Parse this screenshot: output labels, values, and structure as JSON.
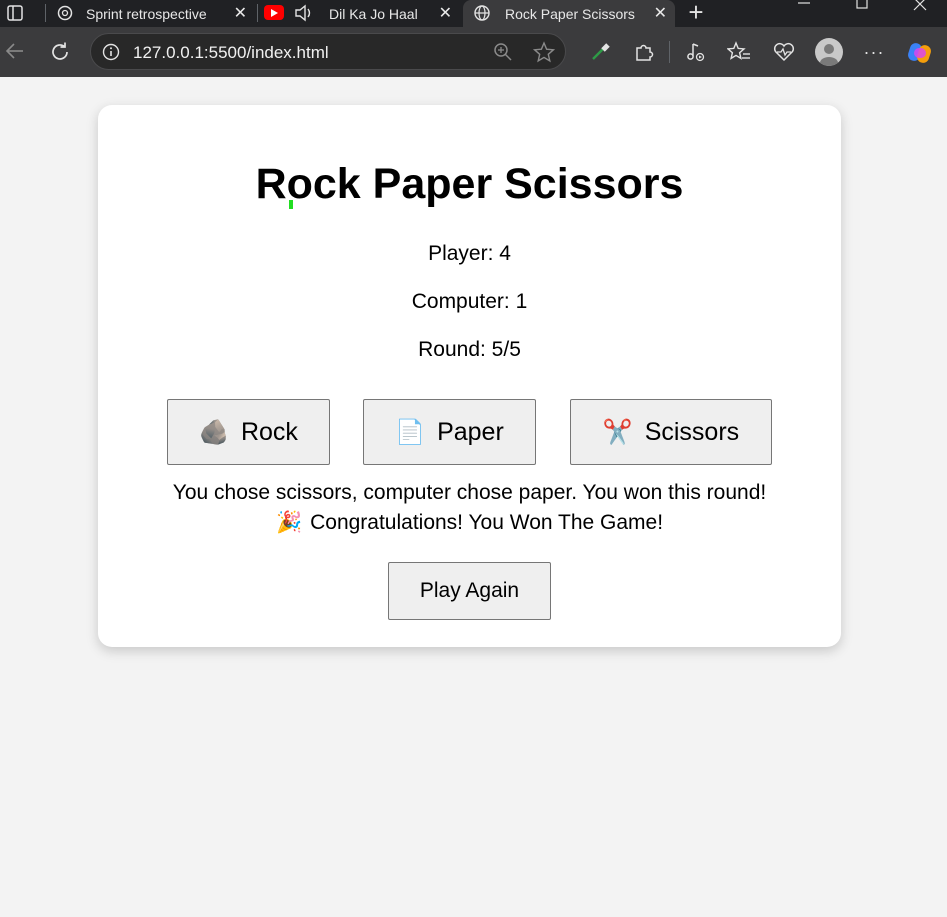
{
  "browser": {
    "tabs": [
      {
        "label": "Sprint retrospective",
        "active": false
      },
      {
        "label": "Dil Ka Jo Haal Hai",
        "active": false
      },
      {
        "label": "Rock Paper Scissors",
        "active": true
      }
    ],
    "url": "127.0.0.1:5500/index.html"
  },
  "game": {
    "title": "Rock Paper Scissors",
    "player_score": "Player: 4",
    "computer_score": "Computer: 1",
    "round": "Round: 5/5",
    "choices": [
      {
        "label": "Rock",
        "icon": "rock-icon",
        "emoji": "🪨"
      },
      {
        "label": "Paper",
        "icon": "paper-icon",
        "emoji": "📄"
      },
      {
        "label": "Scissors",
        "icon": "scissors-icon",
        "emoji": "✂️"
      }
    ],
    "result": "You chose scissors, computer chose paper. You won this round!",
    "final_message": "Congratulations! You Won The Game!",
    "final_emoji": "🎉",
    "play_again_label": "Play Again"
  }
}
